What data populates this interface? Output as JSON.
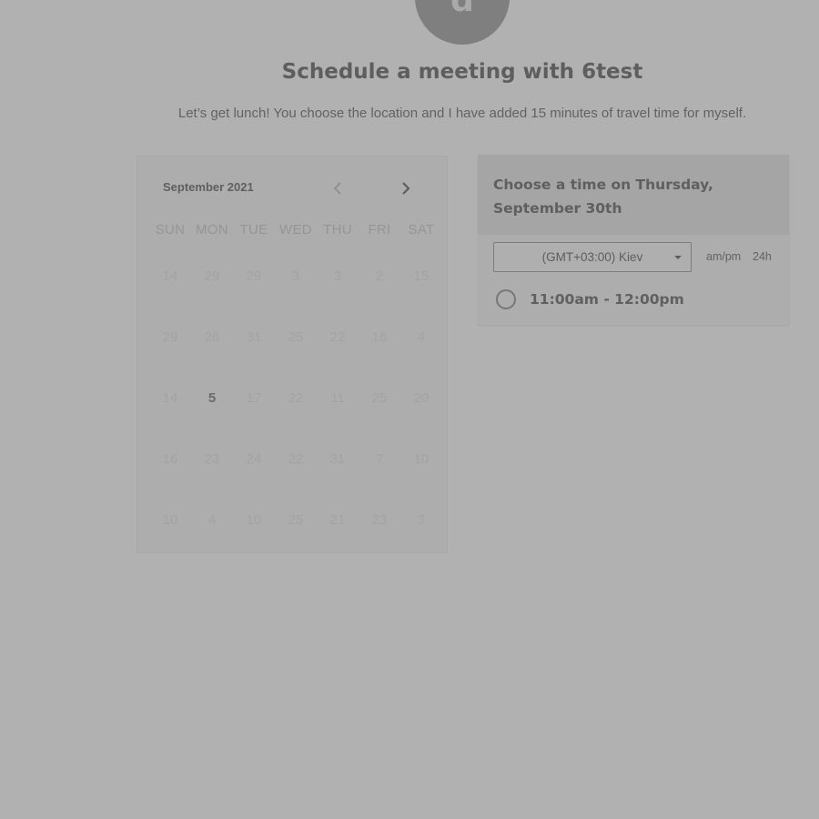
{
  "avatar": {
    "initial": "d"
  },
  "title": "Schedule a meeting with 6test",
  "subtitle": "Let’s get lunch! You choose the location and I have added 15 minutes of travel time for myself.",
  "calendar": {
    "month_label": "September 2021",
    "prev_icon": "chevron-left-icon",
    "next_icon": "chevron-right-icon",
    "weekdays": [
      "SUN",
      "MON",
      "TUE",
      "WED",
      "THU",
      "FRI",
      "SAT"
    ],
    "days": [
      "14",
      "29",
      "29",
      "3",
      "3",
      "2",
      "15",
      "29",
      "26",
      "31",
      "25",
      "22",
      "16",
      "4",
      "14",
      "5",
      "17",
      "22",
      "11",
      "25",
      "20",
      "16",
      "23",
      "24",
      "22",
      "31",
      "7",
      "10",
      "10",
      "4",
      "10",
      "25",
      "21",
      "23",
      "3"
    ],
    "available_day_index": 15
  },
  "time_panel": {
    "heading": "Choose a time on Thursday, September 30th",
    "timezone": "(GMT+03:00) Kiev",
    "format_ampm": "am/pm",
    "format_24h": "24h",
    "slots": [
      "11:00am - 12:00pm"
    ]
  },
  "colors": {
    "background": "#b1b1b1",
    "card": "#adadad",
    "header_band": "#a5a5a5"
  }
}
